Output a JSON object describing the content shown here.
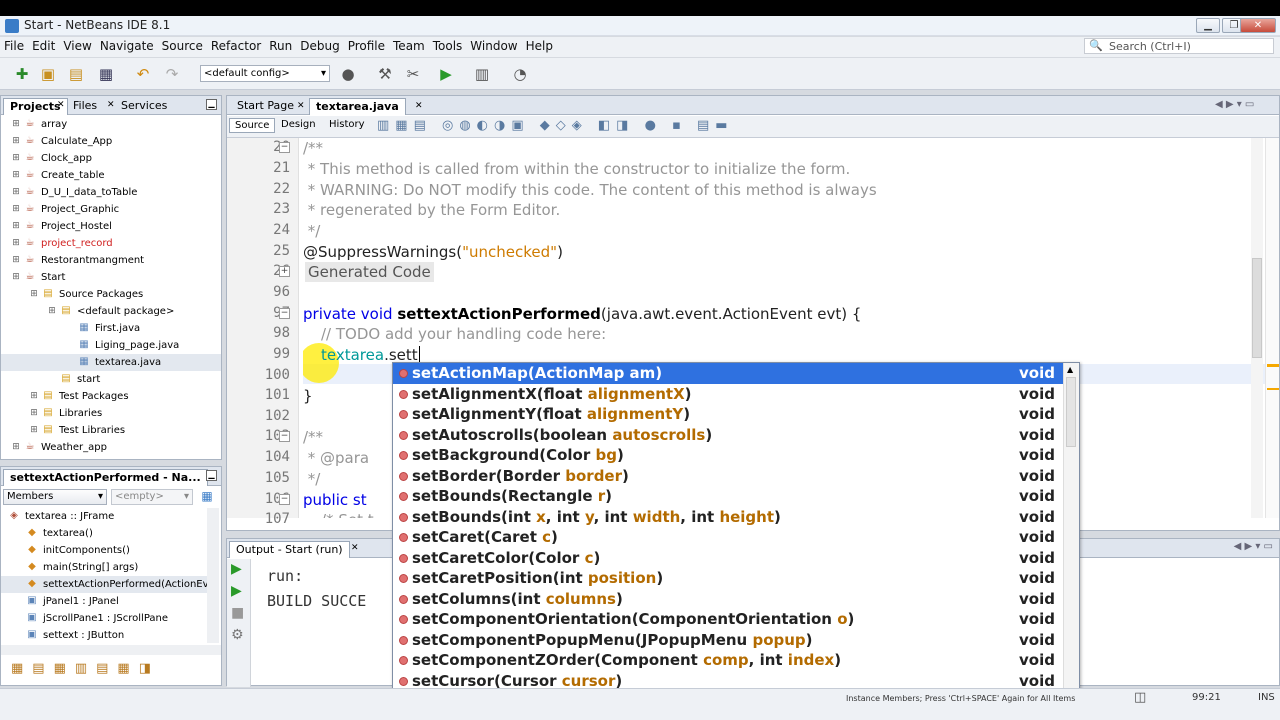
{
  "window": {
    "title": "Start - NetBeans IDE 8.1"
  },
  "menu": [
    "File",
    "Edit",
    "View",
    "Navigate",
    "Source",
    "Refactor",
    "Run",
    "Debug",
    "Profile",
    "Team",
    "Tools",
    "Window",
    "Help"
  ],
  "search": {
    "placeholder": "Search (Ctrl+I)"
  },
  "toolbar": {
    "config": "<default config>"
  },
  "projects_panel": {
    "tabs": [
      "Projects",
      "Files",
      "Services"
    ],
    "tree": [
      {
        "label": "array",
        "depth": 0,
        "kind": "project"
      },
      {
        "label": "Calculate_App",
        "depth": 0,
        "kind": "project"
      },
      {
        "label": "Clock_app",
        "depth": 0,
        "kind": "project"
      },
      {
        "label": "Create_table",
        "depth": 0,
        "kind": "project"
      },
      {
        "label": "D_U_I_data_toTable",
        "depth": 0,
        "kind": "project"
      },
      {
        "label": "Project_Graphic",
        "depth": 0,
        "kind": "project"
      },
      {
        "label": "Project_Hostel",
        "depth": 0,
        "kind": "project"
      },
      {
        "label": "project_record",
        "depth": 0,
        "kind": "project-error"
      },
      {
        "label": "Restorantmangment",
        "depth": 0,
        "kind": "project"
      },
      {
        "label": "Start",
        "depth": 0,
        "kind": "project"
      },
      {
        "label": "Source Packages",
        "depth": 1,
        "kind": "folder"
      },
      {
        "label": "<default package>",
        "depth": 2,
        "kind": "package"
      },
      {
        "label": "First.java",
        "depth": 3,
        "kind": "form"
      },
      {
        "label": "Liging_page.java",
        "depth": 3,
        "kind": "form"
      },
      {
        "label": "textarea.java",
        "depth": 3,
        "kind": "form-selected"
      },
      {
        "label": "start",
        "depth": 2,
        "kind": "package"
      },
      {
        "label": "Test Packages",
        "depth": 1,
        "kind": "folder"
      },
      {
        "label": "Libraries",
        "depth": 1,
        "kind": "folder"
      },
      {
        "label": "Test Libraries",
        "depth": 1,
        "kind": "folder"
      },
      {
        "label": "Weather_app",
        "depth": 0,
        "kind": "project"
      }
    ]
  },
  "navigator": {
    "title": "settextActionPerformed - Na...",
    "filter": "Members",
    "scope": "<empty>",
    "items": [
      {
        "label": "textarea :: JFrame",
        "depth": 0
      },
      {
        "label": "textarea()",
        "depth": 1
      },
      {
        "label": "initComponents()",
        "depth": 1
      },
      {
        "label": "main(String[] args)",
        "depth": 1
      },
      {
        "label": "settextActionPerformed(ActionEver",
        "depth": 1
      },
      {
        "label": "jPanel1 : JPanel",
        "depth": 1
      },
      {
        "label": "jScrollPane1 : JScrollPane",
        "depth": 1
      },
      {
        "label": "settext : JButton",
        "depth": 1
      }
    ]
  },
  "editor": {
    "tabs": [
      "Start Page",
      "textarea.java"
    ],
    "views": [
      "Source",
      "Design",
      "History"
    ],
    "line_numbers": [
      "20",
      "21",
      "22",
      "23",
      "24",
      "25",
      "26",
      "96",
      "97",
      "98",
      "99",
      "100",
      "101",
      "102",
      "103",
      "104",
      "105",
      "106",
      "107"
    ]
  },
  "code": {
    "l20": "/**",
    "l21": " * This method is called from within the constructor to initialize the form.",
    "l22": " * WARNING: Do NOT modify this code. The content of this method is always",
    "l23": " * regenerated by the Form Editor.",
    "l24": " */",
    "l25a": "@SuppressWarnings(",
    "l25b": "\"unchecked\"",
    "l25c": ")",
    "l26": "Generated Code",
    "l97a": "private void ",
    "l97b": "settextActionPerformed",
    "l97c": "(java.awt.event.ActionEvent evt) {",
    "l98": "// TODO add your handling code here:",
    "l99a": "textarea",
    "l99b": ".sett",
    "l101": "}",
    "l103": "/**",
    "l104": " * @para",
    "l105": " */",
    "l106a": "public st",
    "l107": "/* Set t"
  },
  "completion": {
    "items": [
      {
        "name": "setActionMap(",
        "params": [
          [
            "ActionMap ",
            "am"
          ]
        ],
        "ret": "void"
      },
      {
        "name": "setAlignmentX(",
        "params": [
          [
            "float ",
            "alignmentX"
          ]
        ],
        "ret": "void"
      },
      {
        "name": "setAlignmentY(",
        "params": [
          [
            "float ",
            "alignmentY"
          ]
        ],
        "ret": "void"
      },
      {
        "name": "setAutoscrolls(",
        "params": [
          [
            "boolean ",
            "autoscrolls"
          ]
        ],
        "ret": "void"
      },
      {
        "name": "setBackground(",
        "params": [
          [
            "Color ",
            "bg"
          ]
        ],
        "ret": "void"
      },
      {
        "name": "setBorder(",
        "params": [
          [
            "Border ",
            "border"
          ]
        ],
        "ret": "void"
      },
      {
        "name": "setBounds(",
        "params": [
          [
            "Rectangle ",
            "r"
          ]
        ],
        "ret": "void"
      },
      {
        "name": "setBounds(",
        "params": [
          [
            "int ",
            "x"
          ],
          [
            "int ",
            "y"
          ],
          [
            "int ",
            "width"
          ],
          [
            "int ",
            "height"
          ]
        ],
        "ret": "void"
      },
      {
        "name": "setCaret(",
        "params": [
          [
            "Caret ",
            "c"
          ]
        ],
        "ret": "void"
      },
      {
        "name": "setCaretColor(",
        "params": [
          [
            "Color ",
            "c"
          ]
        ],
        "ret": "void"
      },
      {
        "name": "setCaretPosition(",
        "params": [
          [
            "int ",
            "position"
          ]
        ],
        "ret": "void"
      },
      {
        "name": "setColumns(",
        "params": [
          [
            "int ",
            "columns"
          ]
        ],
        "ret": "void"
      },
      {
        "name": "setComponentOrientation(",
        "params": [
          [
            "ComponentOrientation ",
            "o"
          ]
        ],
        "ret": "void"
      },
      {
        "name": "setComponentPopupMenu(",
        "params": [
          [
            "JPopupMenu ",
            "popup"
          ]
        ],
        "ret": "void"
      },
      {
        "name": "setComponentZOrder(",
        "params": [
          [
            "Component ",
            "comp"
          ],
          [
            "int ",
            "index"
          ]
        ],
        "ret": "void"
      },
      {
        "name": "setCursor(",
        "params": [
          [
            "Cursor ",
            "cursor"
          ]
        ],
        "ret": "void"
      }
    ],
    "hint": "Instance Members; Press 'Ctrl+SPACE' Again for All Items"
  },
  "output": {
    "tab": "Output - Start (run)",
    "lines": [
      "run:",
      "BUILD SUCCE"
    ]
  },
  "status": {
    "position": "99:21",
    "mode": "INS"
  }
}
